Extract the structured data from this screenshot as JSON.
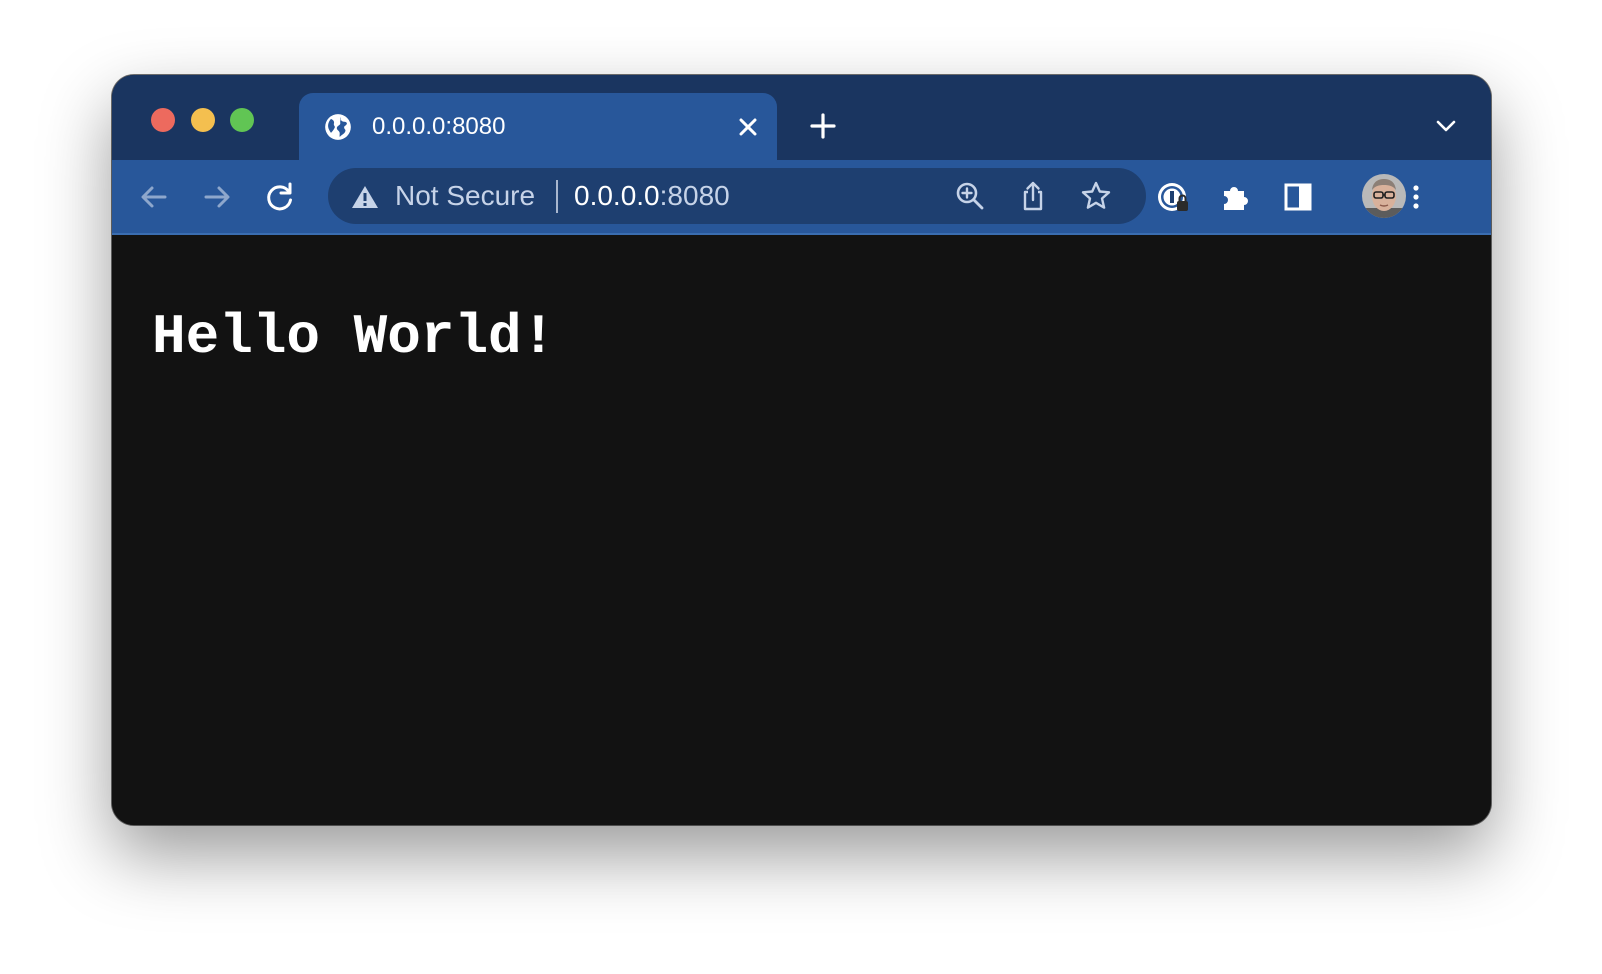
{
  "window": {
    "traffic_lights": [
      {
        "name": "close",
        "color": "#ed6a5e"
      },
      {
        "name": "minimize",
        "color": "#f4bf4f"
      },
      {
        "name": "zoom",
        "color": "#61c554"
      }
    ]
  },
  "tab": {
    "title": "0.0.0.0:8080",
    "favicon": "globe-icon"
  },
  "toolbar": {
    "security_label": "Not Secure",
    "url_host": "0.0.0.0",
    "url_port": ":8080",
    "icons": [
      "back-icon",
      "forward-icon",
      "reload-icon",
      "warning-icon",
      "zoom-icon",
      "share-icon",
      "bookmark-star-icon",
      "password-manager-icon",
      "extensions-icon",
      "side-panel-icon",
      "menu-icon"
    ]
  },
  "page": {
    "heading": "Hello World!"
  },
  "colors": {
    "tabstrip": "#1a3560",
    "toolbar": "#28579a",
    "omnibox": "#1e3f70",
    "content_bg": "#121212",
    "text": "#ffffff"
  }
}
